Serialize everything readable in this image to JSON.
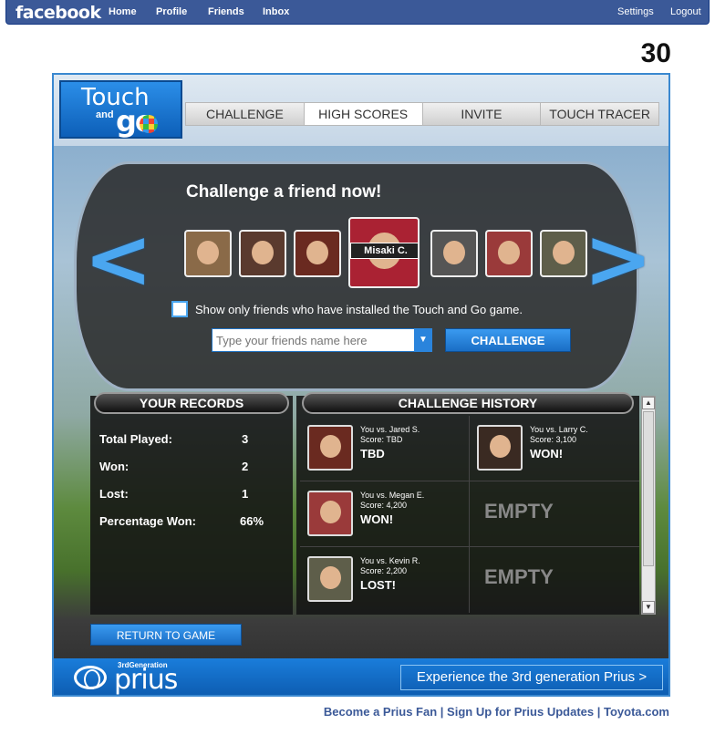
{
  "facebook": {
    "logo": "facebook",
    "nav": [
      "Home",
      "Profile",
      "Friends",
      "Inbox"
    ],
    "settings": "Settings",
    "logout": "Logout"
  },
  "page_number": "30",
  "app": {
    "logo_touch": "Touch",
    "logo_and": "and",
    "logo_go": "go",
    "tabs": [
      {
        "label": "CHALLENGE"
      },
      {
        "label": "HIGH SCORES"
      },
      {
        "label": "INVITE"
      },
      {
        "label": "TOUCH TRACER"
      }
    ],
    "active_tab": "HIGH SCORES",
    "challenge_title": "Challenge a friend now!",
    "selected_friend": "Misaki C.",
    "checkbox_label": "Show only friends who have installed the Touch and Go game.",
    "friend_input_placeholder": "Type your friends name here",
    "challenge_button": "CHALLENGE",
    "records": {
      "title": "YOUR RECORDS",
      "rows": [
        {
          "label": "Total Played:",
          "value": "3"
        },
        {
          "label": "Won:",
          "value": "2"
        },
        {
          "label": "Lost:",
          "value": "1"
        },
        {
          "label": "Percentage Won:",
          "value": "66%"
        }
      ]
    },
    "history": {
      "title": "CHALLENGE HISTORY",
      "entries": [
        {
          "vs": "You vs. Jared S.",
          "score": "Score: TBD",
          "result": "TBD"
        },
        {
          "vs": "You vs. Larry C.",
          "score": "Score: 3,100",
          "result": "WON!"
        },
        {
          "vs": "You vs. Megan E.",
          "score": "Score: 4,200",
          "result": "WON!"
        },
        {
          "empty": "EMPTY"
        },
        {
          "vs": "You vs. Kevin R.",
          "score": "Score: 2,200",
          "result": "LOST!"
        },
        {
          "empty": "EMPTY"
        }
      ]
    },
    "return_button": "RETURN TO GAME",
    "footer": {
      "gen_label": "3rdGeneration",
      "brand": "prius",
      "experience_button": "Experience the 3rd generation Prius >"
    }
  },
  "bottom_links": [
    "Become a Prius Fan",
    "Sign Up for Prius Updates",
    "Toyota.com"
  ],
  "colors": {
    "facebook_blue": "#3b5998",
    "accent_blue": "#2a84dc",
    "arrow_blue": "#4aa6f0"
  }
}
